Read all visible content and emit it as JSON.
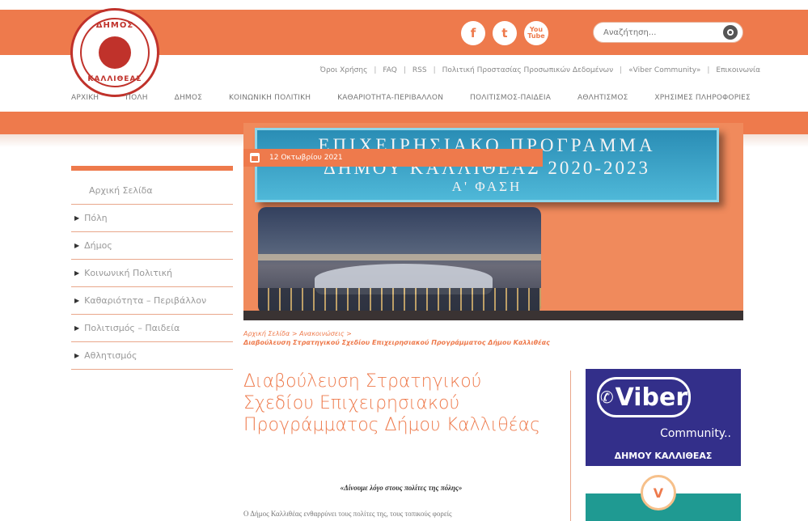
{
  "logo": {
    "top": "ΔΗΜΟΣ",
    "bottom": "ΚΑΛΛΙΘΕΑΣ"
  },
  "social": {
    "facebook": "f",
    "twitter": "t",
    "youtube": "You Tube"
  },
  "search": {
    "placeholder": "Αναζήτηση..."
  },
  "util_links": [
    "Όροι Χρήσης",
    "FAQ",
    "RSS",
    "Πολιτική Προστασίας Προσωπικών Δεδομένων",
    "«Viber Community»",
    "Επικοινωνία"
  ],
  "main_nav": [
    "ΑΡΧΙΚΗ",
    "ΠΟΛΗ",
    "ΔΗΜΟΣ",
    "ΚΟΙΝΩΝΙΚΗ ΠΟΛΙΤΙΚΗ",
    "ΚΑΘΑΡΙΟΤΗΤΑ-ΠΕΡΙΒΑΛΛΟΝ",
    "ΠΟΛΙΤΙΣΜΟΣ-ΠΑΙΔΕΙΑ",
    "ΑΘΛΗΤΙΣΜΟΣ",
    "ΧΡΗΣΙΜΕΣ ΠΛΗΡΟΦΟΡΙΕΣ"
  ],
  "sidebar": {
    "home": "Αρχική Σελίδα",
    "items": [
      "Πόλη",
      "Δήμος",
      "Κοινωνική Πολιτική",
      "Καθαριότητα – Περιβάλλον",
      "Πολιτισμός – Παιδεία",
      "Αθλητισμός"
    ]
  },
  "hero": {
    "line1": "ΕΠΙΧΕΙΡΗΣΙΑΚΟ ΠΡΟΓΡΑΜΜΑ",
    "line2": "ΔΗΜΟΥ ΚΑΛΛΙΘΕΑΣ 2020-2023",
    "line3": "Α' ΦΑΣΗ",
    "date": "12 Οκτωβρίου 2021"
  },
  "breadcrumb": {
    "home": "Αρχική Σελίδα",
    "section": "Ανακοινώσεις",
    "current": "Διαβούλευση Στρατηγικού Σχεδίου Επιχειρησιακού Προγράμματος Δήμου Καλλιθέας"
  },
  "article": {
    "title": "Διαβούλευση Στρατηγικού Σχεδίου Επιχειρησιακού Προγράμματος Δήμου Καλλιθέας",
    "subtitle": "«Δίνουμε λόγο στους πολίτες της πόλης»",
    "body": "Ο Δήμος Καλλιθέας ενθαρρύνει τους πολίτες της, τους τοπικούς φορείς"
  },
  "viber_ad": {
    "brand": "Viber",
    "community": "Community..",
    "city": "ΔΗΜΟΥ ΚΑΛΛΙΘΕΑΣ"
  },
  "colors": {
    "accent": "#ee7a4c",
    "viber": "#332f8a",
    "teal": "#1f9a92"
  }
}
